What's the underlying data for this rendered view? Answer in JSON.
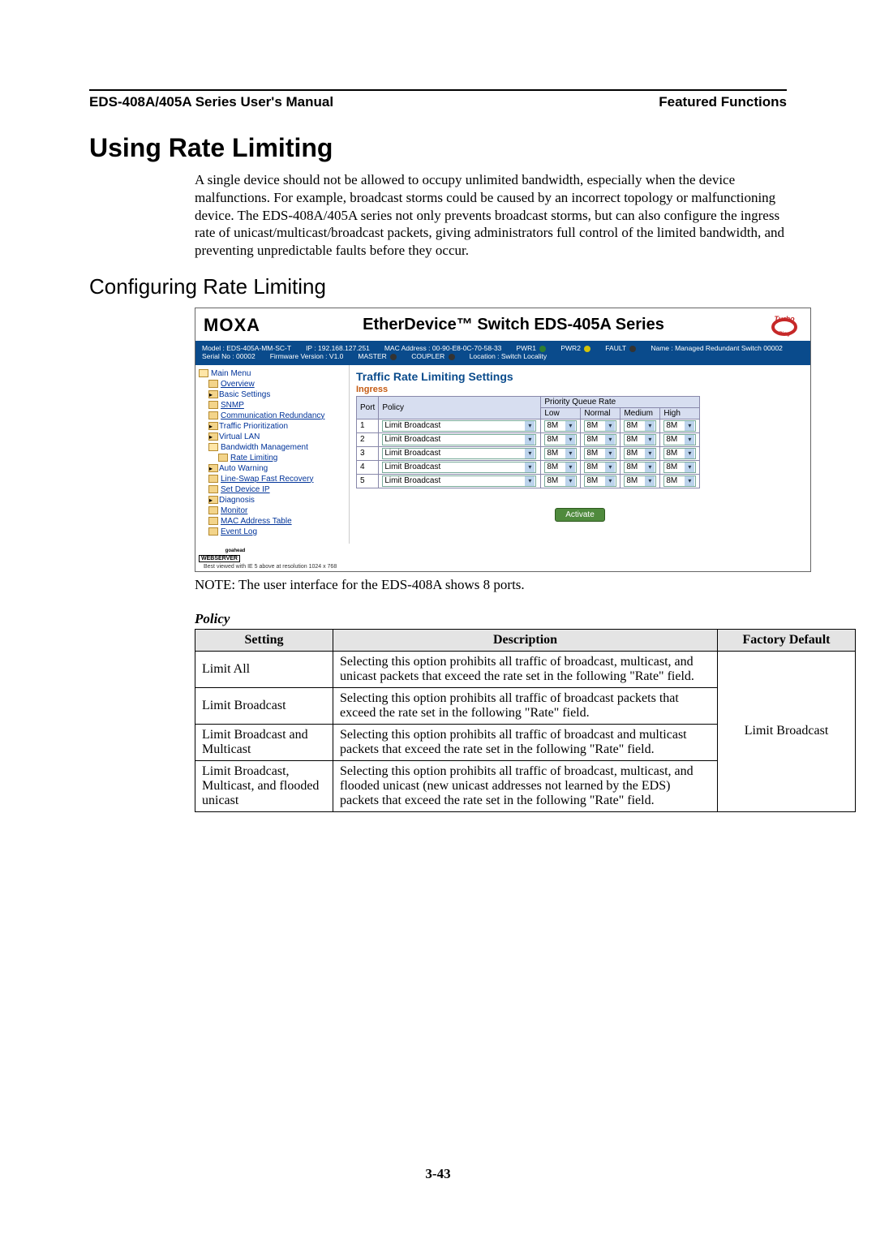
{
  "header": {
    "left": "EDS-408A/405A Series User's Manual",
    "right": "Featured Functions"
  },
  "h1": "Using Rate Limiting",
  "intro": "A single device should not be allowed to occupy unlimited bandwidth, especially when the device malfunctions. For example, broadcast storms could be caused by an incorrect topology or malfunctioning device. The EDS-408A/405A series not only prevents broadcast storms, but can also configure the ingress rate of unicast/multicast/broadcast packets, giving administrators full control of the limited bandwidth, and preventing unpredictable faults before they occur.",
  "h2": "Configuring Rate Limiting",
  "device": {
    "brand": "MOXA",
    "product": "EtherDevice™ Switch EDS-405A Series",
    "turbo_label": "Turbo",
    "status": {
      "model": "Model : EDS-405A-MM-SC-T",
      "ip": "IP : 192.168.127.251",
      "mac": "MAC Address : 00-90-E8-0C-70-58-33",
      "pwr1": "PWR1",
      "pwr2": "PWR2",
      "fault": "FAULT",
      "name": "Name : Managed Redundant Switch 00002",
      "serial": "Serial No : 00002",
      "fw": "Firmware Version : V1.0",
      "master": "MASTER",
      "coupler": "COUPLER",
      "location": "Location : Switch Locality"
    },
    "nav": [
      {
        "lvl": 0,
        "cls": "folder open",
        "label": "Main Menu"
      },
      {
        "lvl": 1,
        "cls": "folder",
        "label": "Overview",
        "link": true
      },
      {
        "lvl": 1,
        "cls": "folder exp",
        "label": "Basic Settings"
      },
      {
        "lvl": 1,
        "cls": "folder",
        "label": "SNMP",
        "link": true
      },
      {
        "lvl": 1,
        "cls": "folder",
        "label": "Communication Redundancy",
        "link": true
      },
      {
        "lvl": 1,
        "cls": "folder exp",
        "label": "Traffic Prioritization"
      },
      {
        "lvl": 1,
        "cls": "folder exp",
        "label": "Virtual LAN"
      },
      {
        "lvl": 1,
        "cls": "folder open",
        "label": "Bandwidth Management"
      },
      {
        "lvl": 2,
        "cls": "folder",
        "label": "Rate Limiting",
        "link": true
      },
      {
        "lvl": 1,
        "cls": "folder exp",
        "label": "Auto Warning"
      },
      {
        "lvl": 1,
        "cls": "folder",
        "label": "Line-Swap Fast Recovery",
        "link": true
      },
      {
        "lvl": 1,
        "cls": "folder",
        "label": "Set Device IP",
        "link": true
      },
      {
        "lvl": 1,
        "cls": "folder exp",
        "label": "Diagnosis"
      },
      {
        "lvl": 1,
        "cls": "folder",
        "label": "Monitor",
        "link": true
      },
      {
        "lvl": 1,
        "cls": "folder",
        "label": "MAC Address Table",
        "link": true
      },
      {
        "lvl": 1,
        "cls": "folder",
        "label": "Event Log",
        "link": true
      }
    ],
    "webserver_top": "goahead",
    "webserver": "WEBSERVER",
    "main": {
      "title": "Traffic Rate Limiting Settings",
      "ingress": "Ingress",
      "thead": {
        "port": "Port",
        "policy": "Policy",
        "pq": "Priority Queue Rate",
        "low": "Low",
        "normal": "Normal",
        "medium": "Medium",
        "high": "High"
      },
      "rows": [
        {
          "port": "1",
          "policy": "Limit Broadcast",
          "low": "8M",
          "normal": "8M",
          "medium": "8M",
          "high": "8M"
        },
        {
          "port": "2",
          "policy": "Limit Broadcast",
          "low": "8M",
          "normal": "8M",
          "medium": "8M",
          "high": "8M"
        },
        {
          "port": "3",
          "policy": "Limit Broadcast",
          "low": "8M",
          "normal": "8M",
          "medium": "8M",
          "high": "8M"
        },
        {
          "port": "4",
          "policy": "Limit Broadcast",
          "low": "8M",
          "normal": "8M",
          "medium": "8M",
          "high": "8M"
        },
        {
          "port": "5",
          "policy": "Limit Broadcast",
          "low": "8M",
          "normal": "8M",
          "medium": "8M",
          "high": "8M"
        }
      ],
      "activate": "Activate"
    },
    "footnote": "Best viewed with IE 5 above at resolution 1024 x 768"
  },
  "note": "NOTE: The user interface for the EDS-408A shows 8 ports.",
  "policy": {
    "heading": "Policy",
    "thead": {
      "setting": "Setting",
      "description": "Description",
      "default": "Factory Default"
    },
    "rows": [
      {
        "setting": "Limit All",
        "desc": "Selecting this option prohibits all traffic of broadcast, multicast, and unicast packets that exceed the rate set in the following \"Rate\" field."
      },
      {
        "setting": "Limit Broadcast",
        "desc": "Selecting this option prohibits all traffic of broadcast packets that exceed the rate set in the following \"Rate\" field."
      },
      {
        "setting": "Limit Broadcast and Multicast",
        "desc": "Selecting this option prohibits all traffic of broadcast and multicast packets that exceed the rate set in the following \"Rate\" field."
      },
      {
        "setting": "Limit Broadcast, Multicast, and flooded unicast",
        "desc": "Selecting this option prohibits all traffic of broadcast, multicast, and flooded unicast (new unicast addresses not learned by the EDS) packets that exceed the rate set in the following \"Rate\" field."
      }
    ],
    "default": "Limit Broadcast"
  },
  "page_num": "3-43"
}
